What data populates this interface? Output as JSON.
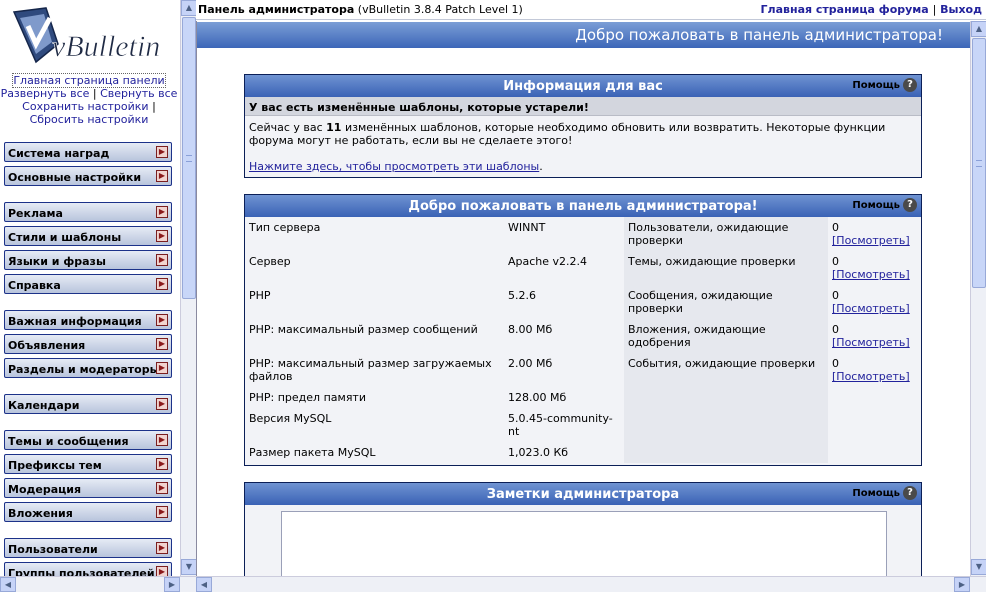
{
  "nav": {
    "logo_text": "vBulletin",
    "links": [
      "Главная страница панели",
      "Развернуть все",
      "Свернуть все",
      "Сохранить настройки",
      "Сбросить настройки"
    ],
    "link_sep": "|",
    "groups": [
      {
        "label": "Система наград"
      },
      {
        "label": "Основные настройки"
      },
      {
        "label": "Реклама"
      },
      {
        "label": "Стили и шаблоны"
      },
      {
        "label": "Языки и фразы"
      },
      {
        "label": "Справка"
      },
      {
        "label": "Важная информация"
      },
      {
        "label": "Объявления"
      },
      {
        "label": "Разделы и модераторы"
      },
      {
        "label": "Календари"
      },
      {
        "label": "Темы и сообщения"
      },
      {
        "label": "Префиксы тем"
      },
      {
        "label": "Модерация"
      },
      {
        "label": "Вложения"
      },
      {
        "label": "Пользователи"
      },
      {
        "label": "Группы пользователей"
      }
    ]
  },
  "topbar": {
    "title": "Панель администратора",
    "version": "(vBulletin 3.8.4 Patch Level 1)",
    "forum_link": "Главная страница форума",
    "sep": "|",
    "logout_link": "Выход"
  },
  "main": {
    "welcome_bar": "Добро пожаловать в панель администратора!",
    "help_label": "Помощь",
    "help_icon": "?",
    "info_panel": {
      "title": "Информация для вас",
      "subhead": "У вас есть изменённые шаблоны, которые устарели!",
      "text_before": "Сейчас у вас ",
      "count": "11",
      "text_after": " изменённых шаблонов, которые необходимо обновить или возвратить. Некоторые функции форума могут не работать, если вы не сделаете этого!",
      "link": "Нажмите здесь, чтобы просмотреть эти шаблоны",
      "link_end": "."
    },
    "stats_panel": {
      "title": "Добро пожаловать в панель администратора!",
      "rows": [
        {
          "label": "Тип сервера",
          "value": "WINNT",
          "mod_label": "Пользователи, ожидающие проверки",
          "mod_count": "0",
          "mod_link": "[Посмотреть]"
        },
        {
          "label": "Сервер",
          "value": "Apache v2.2.4",
          "mod_label": "Темы, ожидающие проверки",
          "mod_count": "0",
          "mod_link": "[Посмотреть]"
        },
        {
          "label": "PHP",
          "value": "5.2.6",
          "mod_label": "Сообщения, ожидающие проверки",
          "mod_count": "0",
          "mod_link": "[Посмотреть]"
        },
        {
          "label": "PHP: максимальный размер сообщений",
          "value": "8.00 Мб",
          "mod_label": "Вложения, ожидающие одобрения",
          "mod_count": "0",
          "mod_link": "[Посмотреть]"
        },
        {
          "label": "PHP: максимальный размер загружаемых файлов",
          "value": "2.00 Мб",
          "mod_label": "События, ожидающие проверки",
          "mod_count": "0",
          "mod_link": "[Посмотреть]"
        },
        {
          "label": "PHP: предел памяти",
          "value": "128.00 Мб",
          "mod_label": "",
          "mod_count": "",
          "mod_link": ""
        },
        {
          "label": "Версия MySQL",
          "value": "5.0.45-community-nt",
          "mod_label": "",
          "mod_count": "",
          "mod_link": ""
        },
        {
          "label": "Размер пакета MySQL",
          "value": "1,023.0 Кб",
          "mod_label": "",
          "mod_count": "",
          "mod_link": ""
        }
      ]
    },
    "notes_panel": {
      "title": "Заметки администратора",
      "content": ""
    }
  },
  "icons": {
    "expand": "expand-arrow-icon",
    "scroll_up": "▲",
    "scroll_down": "▼",
    "scroll_left": "◀",
    "scroll_right": "▶"
  },
  "colors": {
    "header_blue": "#3a62b5",
    "link": "#22229c",
    "nav_border": "#1c3289"
  }
}
